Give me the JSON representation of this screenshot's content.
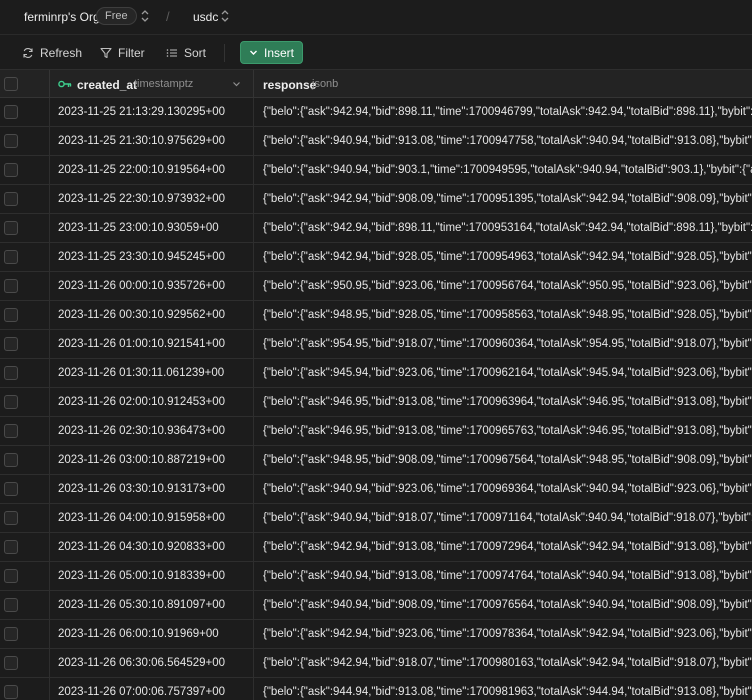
{
  "topbar": {
    "org_name": "ferminrp's Org",
    "plan_badge": "Free",
    "separator": "/",
    "project_name": "usdc"
  },
  "toolbar": {
    "refresh_label": "Refresh",
    "filter_label": "Filter",
    "sort_label": "Sort",
    "insert_label": "Insert"
  },
  "colors": {
    "background": "#1c1c1c",
    "header_background": "#232323",
    "accent_green": "#2f7d57",
    "key_icon": "#3ecf8e"
  },
  "table": {
    "columns": [
      {
        "name": "created_at",
        "type": "timestamptz",
        "primary_key": true
      },
      {
        "name": "response",
        "type": "jsonb"
      }
    ],
    "rows": [
      {
        "created_at": "2023-11-25 21:13:29.130295+00",
        "response": "{\"belo\":{\"ask\":942.94,\"bid\":898.11,\"time\":1700946799,\"totalAsk\":942.94,\"totalBid\":898.11},\"bybit\":{\"ask"
      },
      {
        "created_at": "2023-11-25 21:30:10.975629+00",
        "response": "{\"belo\":{\"ask\":940.94,\"bid\":913.08,\"time\":1700947758,\"totalAsk\":940.94,\"totalBid\":913.08},\"bybit\":{\"ask"
      },
      {
        "created_at": "2023-11-25 22:00:10.919564+00",
        "response": "{\"belo\":{\"ask\":940.94,\"bid\":903.1,\"time\":1700949595,\"totalAsk\":940.94,\"totalBid\":903.1},\"bybit\":{\"ask"
      },
      {
        "created_at": "2023-11-25 22:30:10.973932+00",
        "response": "{\"belo\":{\"ask\":942.94,\"bid\":908.09,\"time\":1700951395,\"totalAsk\":942.94,\"totalBid\":908.09},\"bybit\":{\"ask"
      },
      {
        "created_at": "2023-11-25 23:00:10.93059+00",
        "response": "{\"belo\":{\"ask\":942.94,\"bid\":898.11,\"time\":1700953164,\"totalAsk\":942.94,\"totalBid\":898.11},\"bybit\":{\"ask"
      },
      {
        "created_at": "2023-11-25 23:30:10.945245+00",
        "response": "{\"belo\":{\"ask\":942.94,\"bid\":928.05,\"time\":1700954963,\"totalAsk\":942.94,\"totalBid\":928.05},\"bybit\":{\"ask"
      },
      {
        "created_at": "2023-11-26 00:00:10.935726+00",
        "response": "{\"belo\":{\"ask\":950.95,\"bid\":923.06,\"time\":1700956764,\"totalAsk\":950.95,\"totalBid\":923.06},\"bybit\":{\"ask"
      },
      {
        "created_at": "2023-11-26 00:30:10.929562+00",
        "response": "{\"belo\":{\"ask\":948.95,\"bid\":928.05,\"time\":1700958563,\"totalAsk\":948.95,\"totalBid\":928.05},\"bybit\":{\"ask"
      },
      {
        "created_at": "2023-11-26 01:00:10.921541+00",
        "response": "{\"belo\":{\"ask\":954.95,\"bid\":918.07,\"time\":1700960364,\"totalAsk\":954.95,\"totalBid\":918.07},\"bybit\":{\"ask"
      },
      {
        "created_at": "2023-11-26 01:30:11.061239+00",
        "response": "{\"belo\":{\"ask\":945.94,\"bid\":923.06,\"time\":1700962164,\"totalAsk\":945.94,\"totalBid\":923.06},\"bybit\":{\"ask"
      },
      {
        "created_at": "2023-11-26 02:00:10.912453+00",
        "response": "{\"belo\":{\"ask\":946.95,\"bid\":913.08,\"time\":1700963964,\"totalAsk\":946.95,\"totalBid\":913.08},\"bybit\":{\"ask"
      },
      {
        "created_at": "2023-11-26 02:30:10.936473+00",
        "response": "{\"belo\":{\"ask\":946.95,\"bid\":913.08,\"time\":1700965763,\"totalAsk\":946.95,\"totalBid\":913.08},\"bybit\":{\"ask"
      },
      {
        "created_at": "2023-11-26 03:00:10.887219+00",
        "response": "{\"belo\":{\"ask\":948.95,\"bid\":908.09,\"time\":1700967564,\"totalAsk\":948.95,\"totalBid\":908.09},\"bybit\":{\"ask"
      },
      {
        "created_at": "2023-11-26 03:30:10.913173+00",
        "response": "{\"belo\":{\"ask\":940.94,\"bid\":923.06,\"time\":1700969364,\"totalAsk\":940.94,\"totalBid\":923.06},\"bybit\":{\"ask"
      },
      {
        "created_at": "2023-11-26 04:00:10.915958+00",
        "response": "{\"belo\":{\"ask\":940.94,\"bid\":918.07,\"time\":1700971164,\"totalAsk\":940.94,\"totalBid\":918.07},\"bybit\":{\"ask"
      },
      {
        "created_at": "2023-11-26 04:30:10.920833+00",
        "response": "{\"belo\":{\"ask\":942.94,\"bid\":913.08,\"time\":1700972964,\"totalAsk\":942.94,\"totalBid\":913.08},\"bybit\":{\"ask"
      },
      {
        "created_at": "2023-11-26 05:00:10.918339+00",
        "response": "{\"belo\":{\"ask\":940.94,\"bid\":913.08,\"time\":1700974764,\"totalAsk\":940.94,\"totalBid\":913.08},\"bybit\":{\"ask"
      },
      {
        "created_at": "2023-11-26 05:30:10.891097+00",
        "response": "{\"belo\":{\"ask\":940.94,\"bid\":908.09,\"time\":1700976564,\"totalAsk\":940.94,\"totalBid\":908.09},\"bybit\":{\"ask"
      },
      {
        "created_at": "2023-11-26 06:00:10.91969+00",
        "response": "{\"belo\":{\"ask\":942.94,\"bid\":923.06,\"time\":1700978364,\"totalAsk\":942.94,\"totalBid\":923.06},\"bybit\":{\"ask"
      },
      {
        "created_at": "2023-11-26 06:30:06.564529+00",
        "response": "{\"belo\":{\"ask\":942.94,\"bid\":918.07,\"time\":1700980163,\"totalAsk\":942.94,\"totalBid\":918.07},\"bybit\":{\"ask"
      },
      {
        "created_at": "2023-11-26 07:00:06.757397+00",
        "response": "{\"belo\":{\"ask\":944.94,\"bid\":913.08,\"time\":1700981963,\"totalAsk\":944.94,\"totalBid\":913.08},\"bybit\":{\"ask"
      }
    ]
  }
}
